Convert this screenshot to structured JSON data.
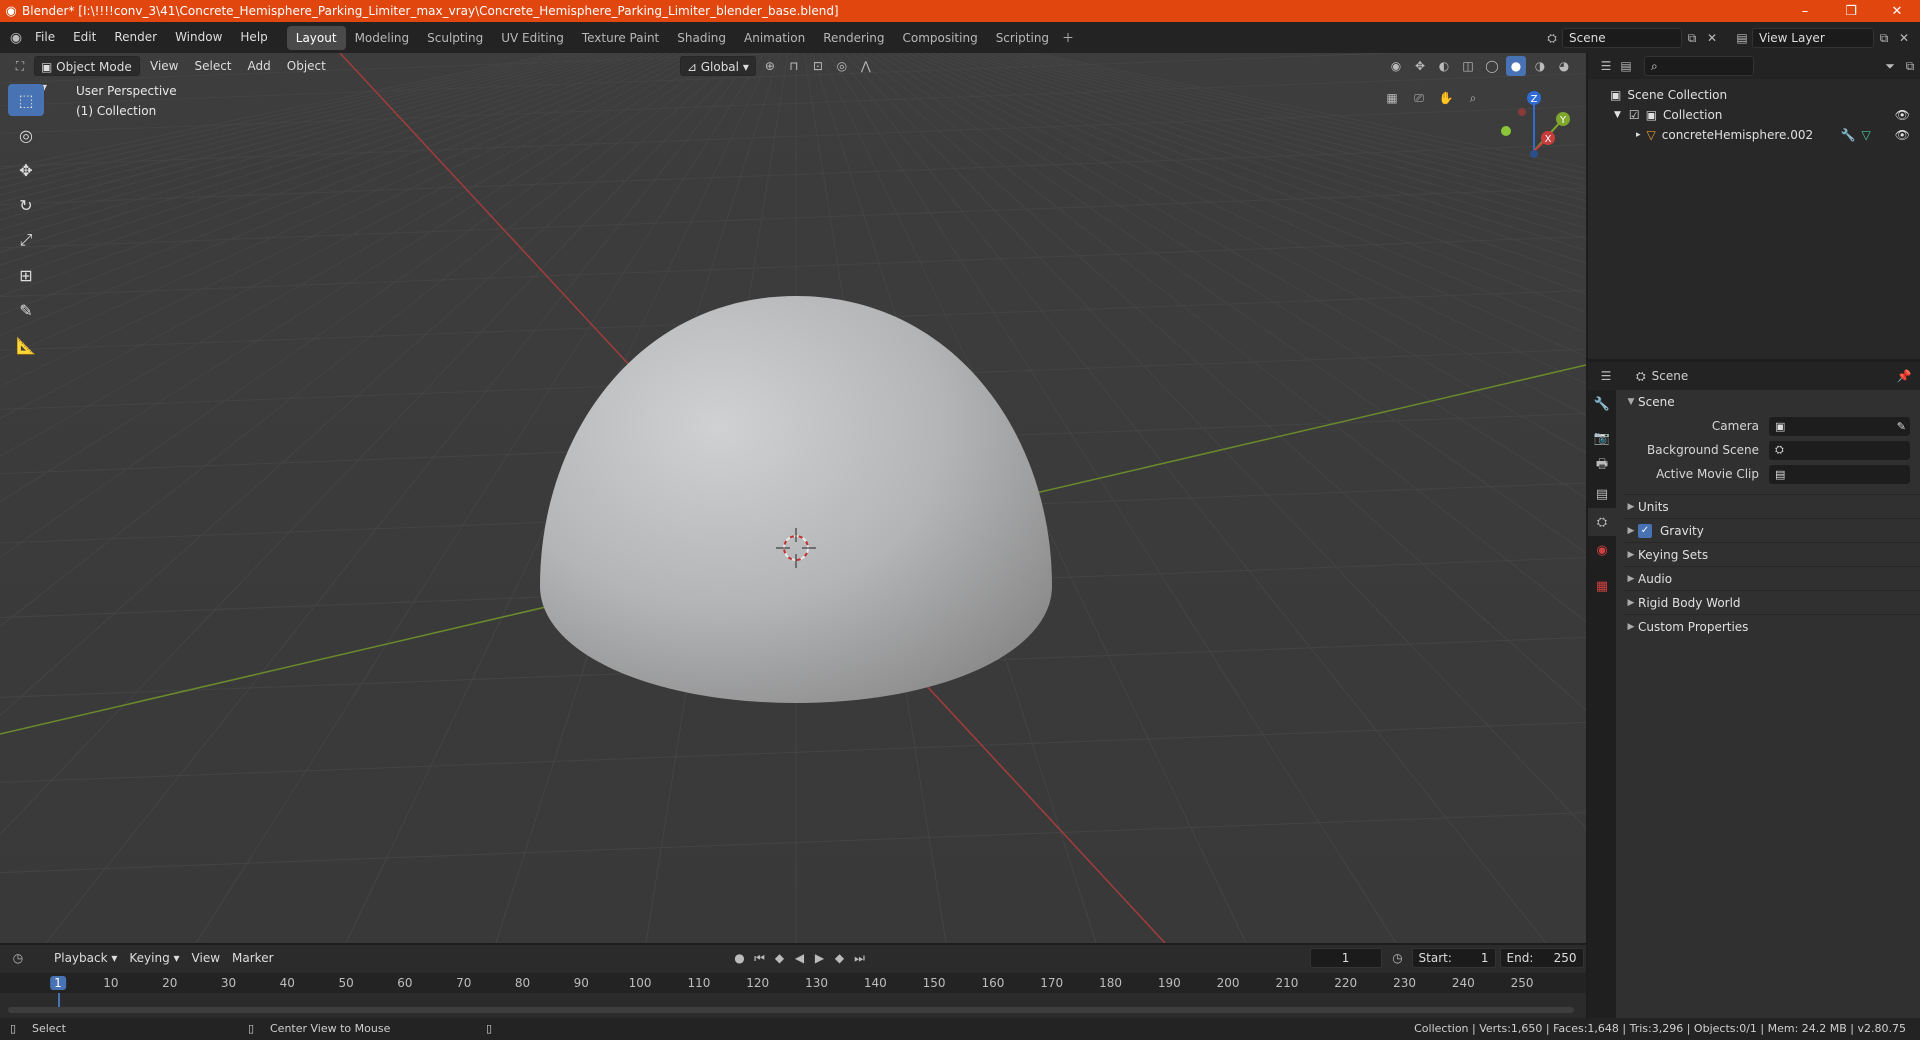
{
  "titlebar": {
    "title": "Blender* [I:\\!!!!conv_3\\41\\Concrete_Hemisphere_Parking_Limiter_max_vray\\Concrete_Hemisphere_Parking_Limiter_blender_base.blend]",
    "color": "#e1460e"
  },
  "menus": [
    "File",
    "Edit",
    "Render",
    "Window",
    "Help"
  ],
  "workspaces": [
    {
      "label": "Layout",
      "active": true
    },
    {
      "label": "Modeling"
    },
    {
      "label": "Sculpting"
    },
    {
      "label": "UV Editing"
    },
    {
      "label": "Texture Paint"
    },
    {
      "label": "Shading"
    },
    {
      "label": "Animation"
    },
    {
      "label": "Rendering"
    },
    {
      "label": "Compositing"
    },
    {
      "label": "Scripting"
    }
  ],
  "scene_field": "Scene",
  "view_layer_field": "View Layer",
  "viewport": {
    "mode": "Object Mode",
    "menus": [
      "View",
      "Select",
      "Add",
      "Object"
    ],
    "transform_orientation": "Global",
    "overlay_title": "User Perspective",
    "overlay_collection": "(1) Collection",
    "gizmo_axes": [
      "X",
      "Y",
      "Z"
    ]
  },
  "outliner": {
    "root": "Scene Collection",
    "collection": "Collection",
    "object": "concreteHemisphere.002"
  },
  "properties": {
    "header": "Scene",
    "section": "Scene",
    "fields": [
      {
        "label": "Camera"
      },
      {
        "label": "Background Scene"
      },
      {
        "label": "Active Movie Clip"
      }
    ],
    "panels": [
      {
        "label": "Units"
      },
      {
        "label": "Gravity",
        "checkbox": true
      },
      {
        "label": "Keying Sets"
      },
      {
        "label": "Audio"
      },
      {
        "label": "Rigid Body World"
      },
      {
        "label": "Custom Properties"
      }
    ]
  },
  "timeline": {
    "menus": [
      "Playback",
      "Keying",
      "View",
      "Marker"
    ],
    "current_frame": "1",
    "start_label": "Start:",
    "start": "1",
    "end_label": "End:",
    "end": "250",
    "ruler": [
      "1",
      "10",
      "20",
      "30",
      "40",
      "50",
      "60",
      "70",
      "80",
      "90",
      "100",
      "110",
      "120",
      "130",
      "140",
      "150",
      "160",
      "170",
      "180",
      "190",
      "200",
      "210",
      "220",
      "230",
      "240",
      "250"
    ]
  },
  "statusbar": {
    "left1": "Select",
    "left2": "Center View to Mouse",
    "right": "Collection | Verts:1,650 | Faces:1,648 | Tris:3,296 | Objects:0/1 | Mem: 24.2 MB | v2.80.75"
  }
}
